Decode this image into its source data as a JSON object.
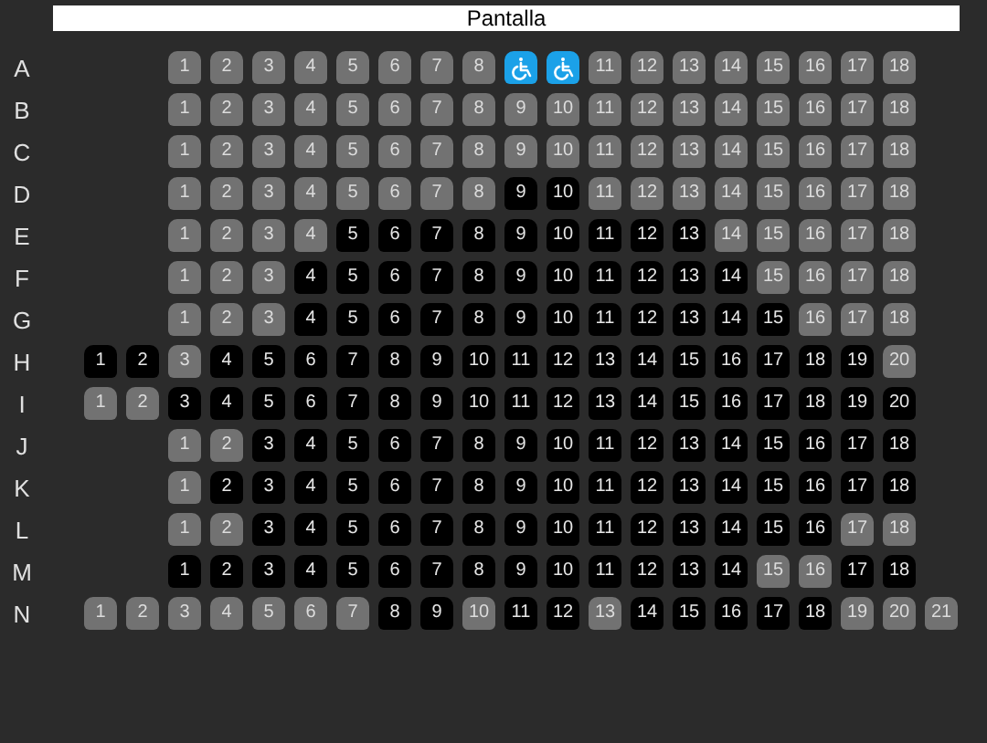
{
  "screen": {
    "label": "Pantalla"
  },
  "rows": [
    {
      "label": "A",
      "seats": [
        {
          "kind": "seat",
          "label": "1",
          "occupied": false
        },
        {
          "kind": "seat",
          "label": "2",
          "occupied": false
        },
        {
          "kind": "seat",
          "label": "3",
          "occupied": false
        },
        {
          "kind": "seat",
          "label": "4",
          "occupied": false
        },
        {
          "kind": "seat",
          "label": "5",
          "occupied": false
        },
        {
          "kind": "seat",
          "label": "6",
          "occupied": false
        },
        {
          "kind": "seat",
          "label": "7",
          "occupied": false
        },
        {
          "kind": "seat",
          "label": "8",
          "occupied": false
        },
        {
          "kind": "wheelchair",
          "occupied": false
        },
        {
          "kind": "wheelchair",
          "occupied": false
        },
        {
          "kind": "seat",
          "label": "11",
          "occupied": false
        },
        {
          "kind": "seat",
          "label": "12",
          "occupied": false
        },
        {
          "kind": "seat",
          "label": "13",
          "occupied": false
        },
        {
          "kind": "seat",
          "label": "14",
          "occupied": false
        },
        {
          "kind": "seat",
          "label": "15",
          "occupied": false
        },
        {
          "kind": "seat",
          "label": "16",
          "occupied": false
        },
        {
          "kind": "seat",
          "label": "17",
          "occupied": false
        },
        {
          "kind": "seat",
          "label": "18",
          "occupied": false
        }
      ]
    },
    {
      "label": "B",
      "seats": [
        {
          "kind": "seat",
          "label": "1",
          "occupied": false
        },
        {
          "kind": "seat",
          "label": "2",
          "occupied": false
        },
        {
          "kind": "seat",
          "label": "3",
          "occupied": false
        },
        {
          "kind": "seat",
          "label": "4",
          "occupied": false
        },
        {
          "kind": "seat",
          "label": "5",
          "occupied": false
        },
        {
          "kind": "seat",
          "label": "6",
          "occupied": false
        },
        {
          "kind": "seat",
          "label": "7",
          "occupied": false
        },
        {
          "kind": "seat",
          "label": "8",
          "occupied": false
        },
        {
          "kind": "seat",
          "label": "9",
          "occupied": false
        },
        {
          "kind": "seat",
          "label": "10",
          "occupied": false
        },
        {
          "kind": "seat",
          "label": "11",
          "occupied": false
        },
        {
          "kind": "seat",
          "label": "12",
          "occupied": false
        },
        {
          "kind": "seat",
          "label": "13",
          "occupied": false
        },
        {
          "kind": "seat",
          "label": "14",
          "occupied": false
        },
        {
          "kind": "seat",
          "label": "15",
          "occupied": false
        },
        {
          "kind": "seat",
          "label": "16",
          "occupied": false
        },
        {
          "kind": "seat",
          "label": "17",
          "occupied": false
        },
        {
          "kind": "seat",
          "label": "18",
          "occupied": false
        }
      ]
    },
    {
      "label": "C",
      "seats": [
        {
          "kind": "seat",
          "label": "1",
          "occupied": false
        },
        {
          "kind": "seat",
          "label": "2",
          "occupied": false
        },
        {
          "kind": "seat",
          "label": "3",
          "occupied": false
        },
        {
          "kind": "seat",
          "label": "4",
          "occupied": false
        },
        {
          "kind": "seat",
          "label": "5",
          "occupied": false
        },
        {
          "kind": "seat",
          "label": "6",
          "occupied": false
        },
        {
          "kind": "seat",
          "label": "7",
          "occupied": false
        },
        {
          "kind": "seat",
          "label": "8",
          "occupied": false
        },
        {
          "kind": "seat",
          "label": "9",
          "occupied": false
        },
        {
          "kind": "seat",
          "label": "10",
          "occupied": false
        },
        {
          "kind": "seat",
          "label": "11",
          "occupied": false
        },
        {
          "kind": "seat",
          "label": "12",
          "occupied": false
        },
        {
          "kind": "seat",
          "label": "13",
          "occupied": false
        },
        {
          "kind": "seat",
          "label": "14",
          "occupied": false
        },
        {
          "kind": "seat",
          "label": "15",
          "occupied": false
        },
        {
          "kind": "seat",
          "label": "16",
          "occupied": false
        },
        {
          "kind": "seat",
          "label": "17",
          "occupied": false
        },
        {
          "kind": "seat",
          "label": "18",
          "occupied": false
        }
      ]
    },
    {
      "label": "D",
      "seats": [
        {
          "kind": "seat",
          "label": "1",
          "occupied": false
        },
        {
          "kind": "seat",
          "label": "2",
          "occupied": false
        },
        {
          "kind": "seat",
          "label": "3",
          "occupied": false
        },
        {
          "kind": "seat",
          "label": "4",
          "occupied": false
        },
        {
          "kind": "seat",
          "label": "5",
          "occupied": false
        },
        {
          "kind": "seat",
          "label": "6",
          "occupied": false
        },
        {
          "kind": "seat",
          "label": "7",
          "occupied": false
        },
        {
          "kind": "seat",
          "label": "8",
          "occupied": false
        },
        {
          "kind": "seat",
          "label": "9",
          "occupied": true
        },
        {
          "kind": "seat",
          "label": "10",
          "occupied": true
        },
        {
          "kind": "seat",
          "label": "11",
          "occupied": false
        },
        {
          "kind": "seat",
          "label": "12",
          "occupied": false
        },
        {
          "kind": "seat",
          "label": "13",
          "occupied": false
        },
        {
          "kind": "seat",
          "label": "14",
          "occupied": false
        },
        {
          "kind": "seat",
          "label": "15",
          "occupied": false
        },
        {
          "kind": "seat",
          "label": "16",
          "occupied": false
        },
        {
          "kind": "seat",
          "label": "17",
          "occupied": false
        },
        {
          "kind": "seat",
          "label": "18",
          "occupied": false
        }
      ]
    },
    {
      "label": "E",
      "seats": [
        {
          "kind": "seat",
          "label": "1",
          "occupied": false
        },
        {
          "kind": "seat",
          "label": "2",
          "occupied": false
        },
        {
          "kind": "seat",
          "label": "3",
          "occupied": false
        },
        {
          "kind": "seat",
          "label": "4",
          "occupied": false
        },
        {
          "kind": "seat",
          "label": "5",
          "occupied": true
        },
        {
          "kind": "seat",
          "label": "6",
          "occupied": true
        },
        {
          "kind": "seat",
          "label": "7",
          "occupied": true
        },
        {
          "kind": "seat",
          "label": "8",
          "occupied": true
        },
        {
          "kind": "seat",
          "label": "9",
          "occupied": true
        },
        {
          "kind": "seat",
          "label": "10",
          "occupied": true
        },
        {
          "kind": "seat",
          "label": "11",
          "occupied": true
        },
        {
          "kind": "seat",
          "label": "12",
          "occupied": true
        },
        {
          "kind": "seat",
          "label": "13",
          "occupied": true
        },
        {
          "kind": "seat",
          "label": "14",
          "occupied": false
        },
        {
          "kind": "seat",
          "label": "15",
          "occupied": false
        },
        {
          "kind": "seat",
          "label": "16",
          "occupied": false
        },
        {
          "kind": "seat",
          "label": "17",
          "occupied": false
        },
        {
          "kind": "seat",
          "label": "18",
          "occupied": false
        }
      ]
    },
    {
      "label": "F",
      "seats": [
        {
          "kind": "seat",
          "label": "1",
          "occupied": false
        },
        {
          "kind": "seat",
          "label": "2",
          "occupied": false
        },
        {
          "kind": "seat",
          "label": "3",
          "occupied": false
        },
        {
          "kind": "seat",
          "label": "4",
          "occupied": true
        },
        {
          "kind": "seat",
          "label": "5",
          "occupied": true
        },
        {
          "kind": "seat",
          "label": "6",
          "occupied": true
        },
        {
          "kind": "seat",
          "label": "7",
          "occupied": true
        },
        {
          "kind": "seat",
          "label": "8",
          "occupied": true
        },
        {
          "kind": "seat",
          "label": "9",
          "occupied": true
        },
        {
          "kind": "seat",
          "label": "10",
          "occupied": true
        },
        {
          "kind": "seat",
          "label": "11",
          "occupied": true
        },
        {
          "kind": "seat",
          "label": "12",
          "occupied": true
        },
        {
          "kind": "seat",
          "label": "13",
          "occupied": true
        },
        {
          "kind": "seat",
          "label": "14",
          "occupied": true
        },
        {
          "kind": "seat",
          "label": "15",
          "occupied": false
        },
        {
          "kind": "seat",
          "label": "16",
          "occupied": false
        },
        {
          "kind": "seat",
          "label": "17",
          "occupied": false
        },
        {
          "kind": "seat",
          "label": "18",
          "occupied": false
        }
      ]
    },
    {
      "label": "G",
      "seats": [
        {
          "kind": "seat",
          "label": "1",
          "occupied": false
        },
        {
          "kind": "seat",
          "label": "2",
          "occupied": false
        },
        {
          "kind": "seat",
          "label": "3",
          "occupied": false
        },
        {
          "kind": "seat",
          "label": "4",
          "occupied": true
        },
        {
          "kind": "seat",
          "label": "5",
          "occupied": true
        },
        {
          "kind": "seat",
          "label": "6",
          "occupied": true
        },
        {
          "kind": "seat",
          "label": "7",
          "occupied": true
        },
        {
          "kind": "seat",
          "label": "8",
          "occupied": true
        },
        {
          "kind": "seat",
          "label": "9",
          "occupied": true
        },
        {
          "kind": "seat",
          "label": "10",
          "occupied": true
        },
        {
          "kind": "seat",
          "label": "11",
          "occupied": true
        },
        {
          "kind": "seat",
          "label": "12",
          "occupied": true
        },
        {
          "kind": "seat",
          "label": "13",
          "occupied": true
        },
        {
          "kind": "seat",
          "label": "14",
          "occupied": true
        },
        {
          "kind": "seat",
          "label": "15",
          "occupied": true
        },
        {
          "kind": "seat",
          "label": "16",
          "occupied": false
        },
        {
          "kind": "seat",
          "label": "17",
          "occupied": false
        },
        {
          "kind": "seat",
          "label": "18",
          "occupied": false
        }
      ]
    },
    {
      "label": "H",
      "seats": [
        {
          "kind": "seat",
          "label": "1",
          "occupied": true
        },
        {
          "kind": "seat",
          "label": "2",
          "occupied": true
        },
        {
          "kind": "seat",
          "label": "3",
          "occupied": false
        },
        {
          "kind": "seat",
          "label": "4",
          "occupied": true
        },
        {
          "kind": "seat",
          "label": "5",
          "occupied": true
        },
        {
          "kind": "seat",
          "label": "6",
          "occupied": true
        },
        {
          "kind": "seat",
          "label": "7",
          "occupied": true
        },
        {
          "kind": "seat",
          "label": "8",
          "occupied": true
        },
        {
          "kind": "seat",
          "label": "9",
          "occupied": true
        },
        {
          "kind": "seat",
          "label": "10",
          "occupied": true
        },
        {
          "kind": "seat",
          "label": "11",
          "occupied": true
        },
        {
          "kind": "seat",
          "label": "12",
          "occupied": true
        },
        {
          "kind": "seat",
          "label": "13",
          "occupied": true
        },
        {
          "kind": "seat",
          "label": "14",
          "occupied": true
        },
        {
          "kind": "seat",
          "label": "15",
          "occupied": true
        },
        {
          "kind": "seat",
          "label": "16",
          "occupied": true
        },
        {
          "kind": "seat",
          "label": "17",
          "occupied": true
        },
        {
          "kind": "seat",
          "label": "18",
          "occupied": true
        },
        {
          "kind": "seat",
          "label": "19",
          "occupied": true
        },
        {
          "kind": "seat",
          "label": "20",
          "occupied": false
        }
      ]
    },
    {
      "label": "I",
      "seats": [
        {
          "kind": "seat",
          "label": "1",
          "occupied": false
        },
        {
          "kind": "seat",
          "label": "2",
          "occupied": false
        },
        {
          "kind": "seat",
          "label": "3",
          "occupied": true
        },
        {
          "kind": "seat",
          "label": "4",
          "occupied": true
        },
        {
          "kind": "seat",
          "label": "5",
          "occupied": true
        },
        {
          "kind": "seat",
          "label": "6",
          "occupied": true
        },
        {
          "kind": "seat",
          "label": "7",
          "occupied": true
        },
        {
          "kind": "seat",
          "label": "8",
          "occupied": true
        },
        {
          "kind": "seat",
          "label": "9",
          "occupied": true
        },
        {
          "kind": "seat",
          "label": "10",
          "occupied": true
        },
        {
          "kind": "seat",
          "label": "11",
          "occupied": true
        },
        {
          "kind": "seat",
          "label": "12",
          "occupied": true
        },
        {
          "kind": "seat",
          "label": "13",
          "occupied": true
        },
        {
          "kind": "seat",
          "label": "14",
          "occupied": true
        },
        {
          "kind": "seat",
          "label": "15",
          "occupied": true
        },
        {
          "kind": "seat",
          "label": "16",
          "occupied": true
        },
        {
          "kind": "seat",
          "label": "17",
          "occupied": true
        },
        {
          "kind": "seat",
          "label": "18",
          "occupied": true
        },
        {
          "kind": "seat",
          "label": "19",
          "occupied": true
        },
        {
          "kind": "seat",
          "label": "20",
          "occupied": true
        }
      ]
    },
    {
      "label": "J",
      "seats": [
        {
          "kind": "seat",
          "label": "1",
          "occupied": false
        },
        {
          "kind": "seat",
          "label": "2",
          "occupied": false
        },
        {
          "kind": "seat",
          "label": "3",
          "occupied": true
        },
        {
          "kind": "seat",
          "label": "4",
          "occupied": true
        },
        {
          "kind": "seat",
          "label": "5",
          "occupied": true
        },
        {
          "kind": "seat",
          "label": "6",
          "occupied": true
        },
        {
          "kind": "seat",
          "label": "7",
          "occupied": true
        },
        {
          "kind": "seat",
          "label": "8",
          "occupied": true
        },
        {
          "kind": "seat",
          "label": "9",
          "occupied": true
        },
        {
          "kind": "seat",
          "label": "10",
          "occupied": true
        },
        {
          "kind": "seat",
          "label": "11",
          "occupied": true
        },
        {
          "kind": "seat",
          "label": "12",
          "occupied": true
        },
        {
          "kind": "seat",
          "label": "13",
          "occupied": true
        },
        {
          "kind": "seat",
          "label": "14",
          "occupied": true
        },
        {
          "kind": "seat",
          "label": "15",
          "occupied": true
        },
        {
          "kind": "seat",
          "label": "16",
          "occupied": true
        },
        {
          "kind": "seat",
          "label": "17",
          "occupied": true
        },
        {
          "kind": "seat",
          "label": "18",
          "occupied": true
        }
      ]
    },
    {
      "label": "K",
      "seats": [
        {
          "kind": "seat",
          "label": "1",
          "occupied": false
        },
        {
          "kind": "seat",
          "label": "2",
          "occupied": true
        },
        {
          "kind": "seat",
          "label": "3",
          "occupied": true
        },
        {
          "kind": "seat",
          "label": "4",
          "occupied": true
        },
        {
          "kind": "seat",
          "label": "5",
          "occupied": true
        },
        {
          "kind": "seat",
          "label": "6",
          "occupied": true
        },
        {
          "kind": "seat",
          "label": "7",
          "occupied": true
        },
        {
          "kind": "seat",
          "label": "8",
          "occupied": true
        },
        {
          "kind": "seat",
          "label": "9",
          "occupied": true
        },
        {
          "kind": "seat",
          "label": "10",
          "occupied": true
        },
        {
          "kind": "seat",
          "label": "11",
          "occupied": true
        },
        {
          "kind": "seat",
          "label": "12",
          "occupied": true
        },
        {
          "kind": "seat",
          "label": "13",
          "occupied": true
        },
        {
          "kind": "seat",
          "label": "14",
          "occupied": true
        },
        {
          "kind": "seat",
          "label": "15",
          "occupied": true
        },
        {
          "kind": "seat",
          "label": "16",
          "occupied": true
        },
        {
          "kind": "seat",
          "label": "17",
          "occupied": true
        },
        {
          "kind": "seat",
          "label": "18",
          "occupied": true
        }
      ]
    },
    {
      "label": "L",
      "seats": [
        {
          "kind": "seat",
          "label": "1",
          "occupied": false
        },
        {
          "kind": "seat",
          "label": "2",
          "occupied": false
        },
        {
          "kind": "seat",
          "label": "3",
          "occupied": true
        },
        {
          "kind": "seat",
          "label": "4",
          "occupied": true
        },
        {
          "kind": "seat",
          "label": "5",
          "occupied": true
        },
        {
          "kind": "seat",
          "label": "6",
          "occupied": true
        },
        {
          "kind": "seat",
          "label": "7",
          "occupied": true
        },
        {
          "kind": "seat",
          "label": "8",
          "occupied": true
        },
        {
          "kind": "seat",
          "label": "9",
          "occupied": true
        },
        {
          "kind": "seat",
          "label": "10",
          "occupied": true
        },
        {
          "kind": "seat",
          "label": "11",
          "occupied": true
        },
        {
          "kind": "seat",
          "label": "12",
          "occupied": true
        },
        {
          "kind": "seat",
          "label": "13",
          "occupied": true
        },
        {
          "kind": "seat",
          "label": "14",
          "occupied": true
        },
        {
          "kind": "seat",
          "label": "15",
          "occupied": true
        },
        {
          "kind": "seat",
          "label": "16",
          "occupied": true
        },
        {
          "kind": "seat",
          "label": "17",
          "occupied": false
        },
        {
          "kind": "seat",
          "label": "18",
          "occupied": false
        }
      ]
    },
    {
      "label": "M",
      "seats": [
        {
          "kind": "seat",
          "label": "1",
          "occupied": true
        },
        {
          "kind": "seat",
          "label": "2",
          "occupied": true
        },
        {
          "kind": "seat",
          "label": "3",
          "occupied": true
        },
        {
          "kind": "seat",
          "label": "4",
          "occupied": true
        },
        {
          "kind": "seat",
          "label": "5",
          "occupied": true
        },
        {
          "kind": "seat",
          "label": "6",
          "occupied": true
        },
        {
          "kind": "seat",
          "label": "7",
          "occupied": true
        },
        {
          "kind": "seat",
          "label": "8",
          "occupied": true
        },
        {
          "kind": "seat",
          "label": "9",
          "occupied": true
        },
        {
          "kind": "seat",
          "label": "10",
          "occupied": true
        },
        {
          "kind": "seat",
          "label": "11",
          "occupied": true
        },
        {
          "kind": "seat",
          "label": "12",
          "occupied": true
        },
        {
          "kind": "seat",
          "label": "13",
          "occupied": true
        },
        {
          "kind": "seat",
          "label": "14",
          "occupied": true
        },
        {
          "kind": "seat",
          "label": "15",
          "occupied": false
        },
        {
          "kind": "seat",
          "label": "16",
          "occupied": false
        },
        {
          "kind": "seat",
          "label": "17",
          "occupied": true
        },
        {
          "kind": "seat",
          "label": "18",
          "occupied": true
        }
      ]
    },
    {
      "label": "N",
      "seats": [
        {
          "kind": "seat",
          "label": "1",
          "occupied": false
        },
        {
          "kind": "seat",
          "label": "2",
          "occupied": false
        },
        {
          "kind": "seat",
          "label": "3",
          "occupied": false
        },
        {
          "kind": "seat",
          "label": "4",
          "occupied": false
        },
        {
          "kind": "seat",
          "label": "5",
          "occupied": false
        },
        {
          "kind": "seat",
          "label": "6",
          "occupied": false
        },
        {
          "kind": "seat",
          "label": "7",
          "occupied": false
        },
        {
          "kind": "seat",
          "label": "8",
          "occupied": true
        },
        {
          "kind": "seat",
          "label": "9",
          "occupied": true
        },
        {
          "kind": "seat",
          "label": "10",
          "occupied": false
        },
        {
          "kind": "seat",
          "label": "11",
          "occupied": true
        },
        {
          "kind": "seat",
          "label": "12",
          "occupied": true
        },
        {
          "kind": "seat",
          "label": "13",
          "occupied": false
        },
        {
          "kind": "seat",
          "label": "14",
          "occupied": true
        },
        {
          "kind": "seat",
          "label": "15",
          "occupied": true
        },
        {
          "kind": "seat",
          "label": "16",
          "occupied": true
        },
        {
          "kind": "seat",
          "label": "17",
          "occupied": true
        },
        {
          "kind": "seat",
          "label": "18",
          "occupied": true
        },
        {
          "kind": "seat",
          "label": "19",
          "occupied": false
        },
        {
          "kind": "seat",
          "label": "20",
          "occupied": false
        },
        {
          "kind": "seat",
          "label": "21",
          "occupied": false
        }
      ]
    }
  ]
}
